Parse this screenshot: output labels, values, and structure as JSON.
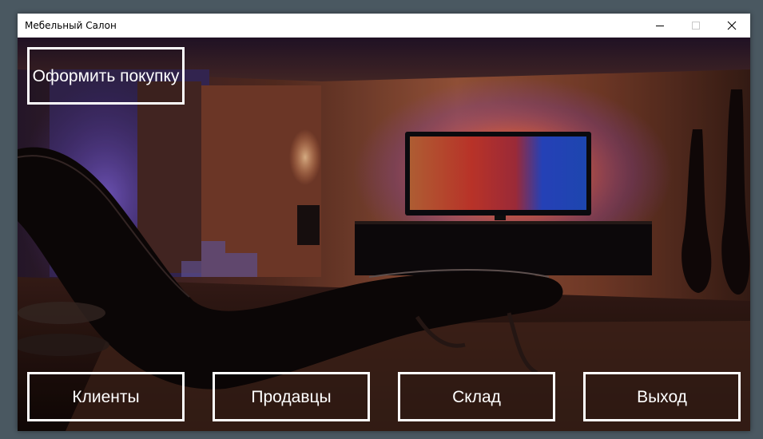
{
  "window": {
    "title": "Мебельный Салон"
  },
  "buttons": {
    "purchase": "Оформить покупку",
    "clients": "Клиенты",
    "sellers": "Продавцы",
    "stock": "Склад",
    "exit": "Выход"
  },
  "icons": {
    "minimize": "minimize-icon",
    "maximize": "maximize-icon",
    "close": "close-icon"
  }
}
